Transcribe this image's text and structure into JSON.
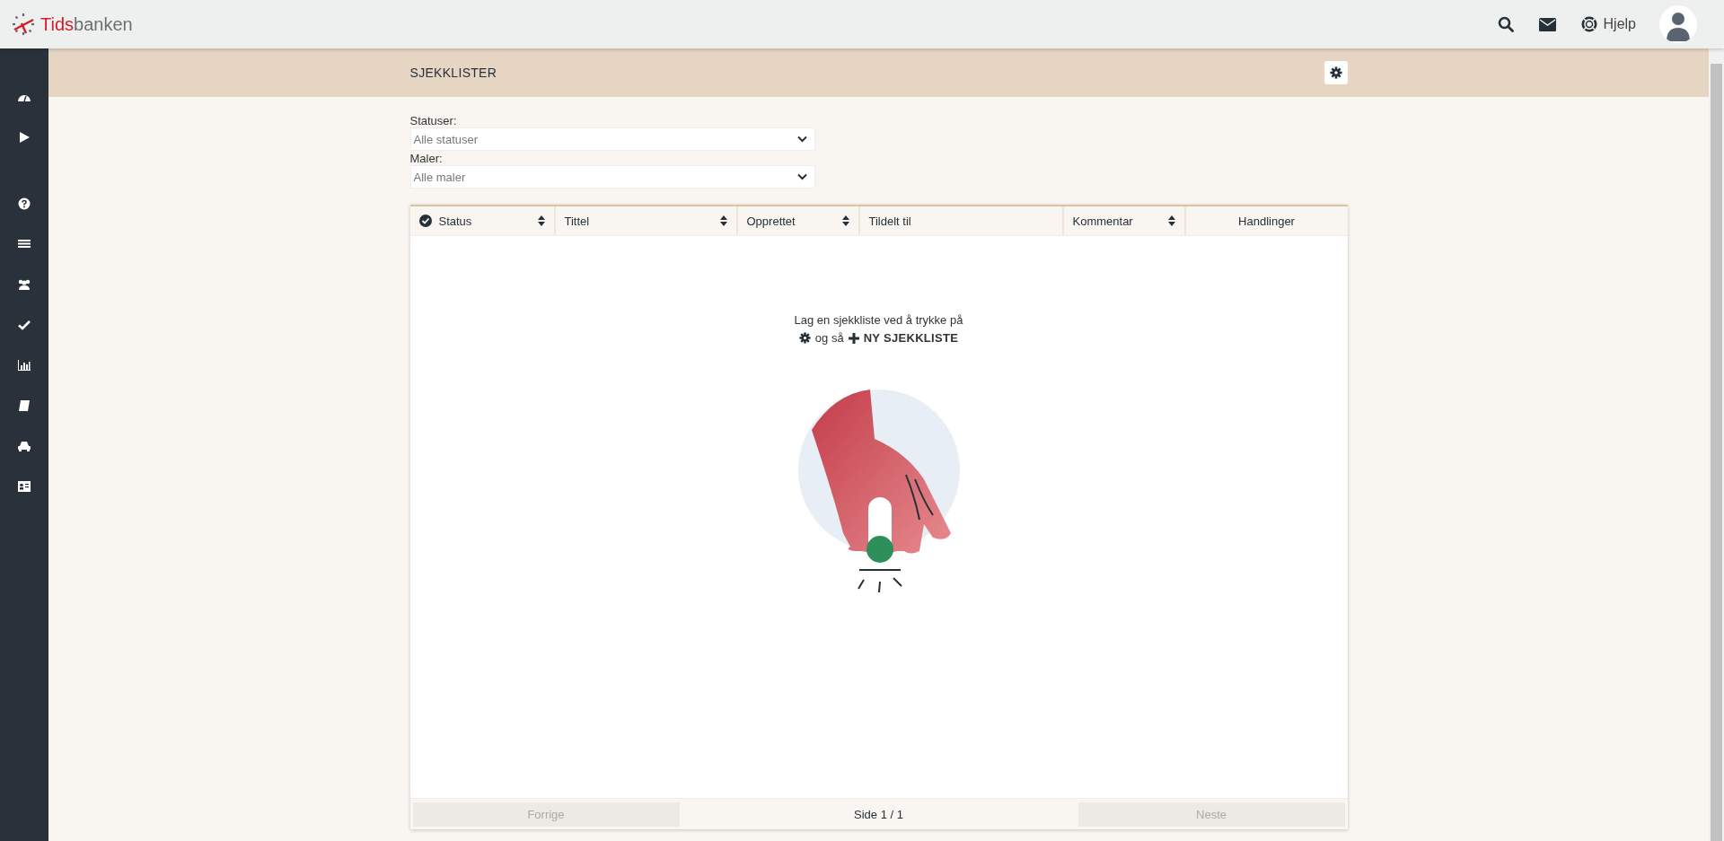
{
  "top_bar": {
    "logo_bold": "Tids",
    "logo_rest": "banken",
    "help_label": "Hjelp"
  },
  "page_header": {
    "title": "SJEKKLISTER"
  },
  "filters": [
    {
      "label": "Statuser:",
      "value": "Alle statuser"
    },
    {
      "label": "Maler:",
      "value": "Alle maler"
    }
  ],
  "table": {
    "columns": [
      {
        "label": "Status",
        "sortable": true,
        "check_icon": true
      },
      {
        "label": "Tittel",
        "sortable": true,
        "check_icon": false
      },
      {
        "label": "Opprettet",
        "sortable": true,
        "check_icon": false
      },
      {
        "label": "Tildelt til",
        "sortable": false,
        "check_icon": false
      },
      {
        "label": "Kommentar",
        "sortable": true,
        "check_icon": false
      },
      {
        "label": "Handlinger",
        "sortable": false,
        "check_icon": false
      }
    ],
    "empty_line_1": "Lag en sjekkliste ved å trykke på",
    "empty_and": "og så",
    "empty_action": "NY SJEKKLISTE"
  },
  "pagination": {
    "previous": {
      "label": "Forrige",
      "disabled": true
    },
    "page": "Side 1 / 1",
    "next": {
      "label": "Neste",
      "disabled": true
    }
  }
}
